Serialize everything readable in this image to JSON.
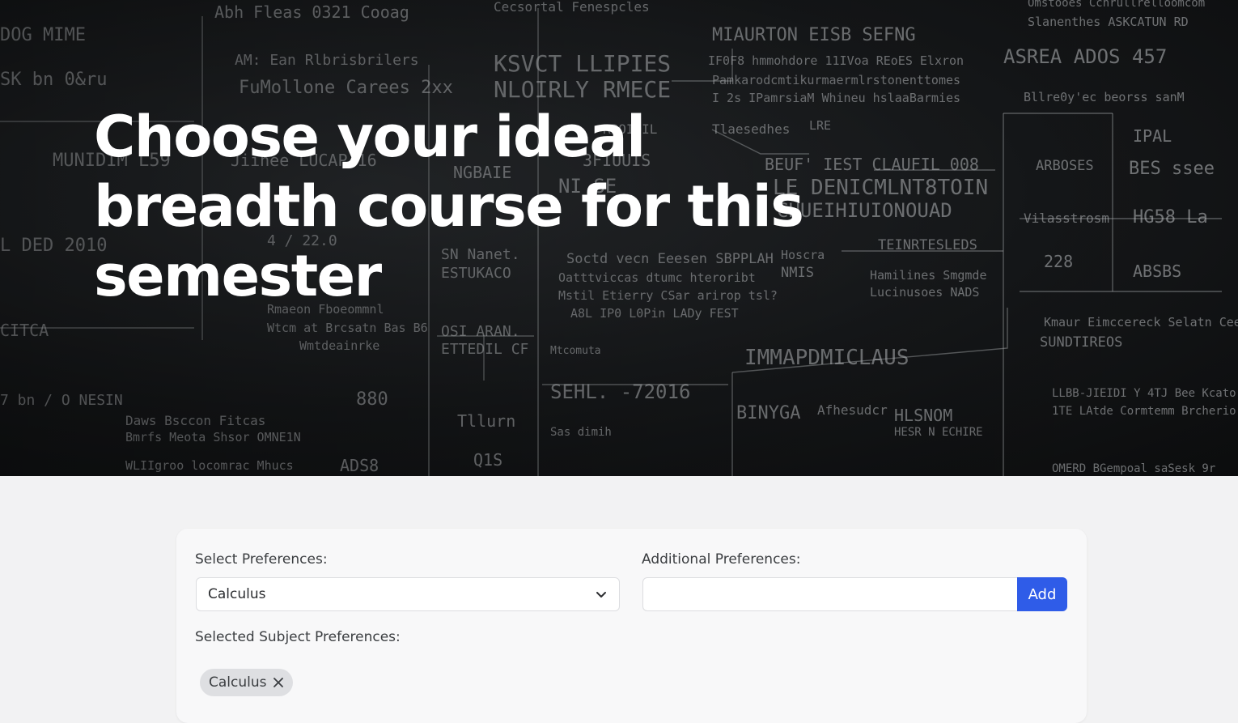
{
  "hero": {
    "title": "Choose your ideal breadth course for this semester"
  },
  "form": {
    "select_label": "Select Preferences:",
    "select_value": "Calculus",
    "additional_label": "Additional Preferences:",
    "additional_value": "",
    "additional_placeholder": "",
    "add_button_label": "Add",
    "selected_label": "Selected Subject Preferences:",
    "selected_chips": [
      {
        "label": "Calculus"
      }
    ]
  },
  "colors": {
    "accent": "#2f5ce8",
    "page_background": "#f2f2f3",
    "chip_background": "#dedfe2"
  },
  "icons": {
    "select_chevron": "chevron-down-icon",
    "chip_remove": "close-icon"
  }
}
